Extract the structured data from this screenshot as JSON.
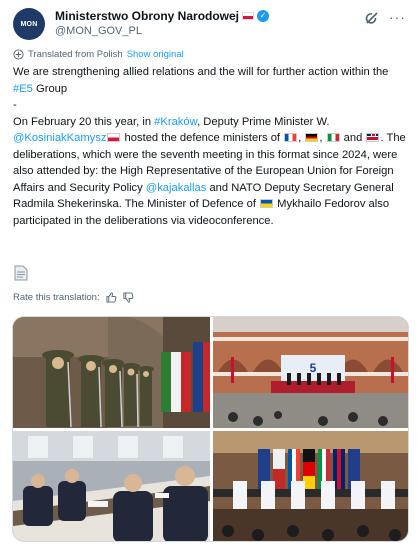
{
  "account": {
    "avatar_text": "MON",
    "display_name": "Ministerstwo Obrony Narodowej",
    "handle": "@MON_GOV_PL"
  },
  "icons": {
    "avatar": "mon-logo",
    "verified": "verified-badge-icon",
    "grok": "grok-icon",
    "more": "more-icon",
    "translate": "translate-icon",
    "document": "document-icon",
    "thumbs_up": "thumbs-up-icon",
    "thumbs_down": "thumbs-down-icon"
  },
  "translation": {
    "notice": "Translated from Polish",
    "show_original": "Show original"
  },
  "tweet": {
    "line1_a": "We are strengthening allied relations and the will for further action within the ",
    "line1_hashtag": "#E5",
    "line1_b": " Group",
    "dash": "-",
    "p2_a": "On February 20 this year, in ",
    "p2_hashtag": "#Kraków",
    "p2_b": ", Deputy Prime Minister W. ",
    "p2_mention1": "@KosiniakKamysz",
    "p2_c": " hosted the defence ministers of ",
    "p2_and": " and ",
    "p2_d": ". The deliberations, which were the seventh meeting in this format since 2024, were also attended by: the High Representative of the European Union for Foreign Affairs and Security Policy ",
    "p2_mention2": "@kajakallas",
    "p2_e": " and NATO Deputy Secretary General Radmila Shekerinska. The Minister of Defence of ",
    "p2_f": " Mykhailo Fedorov also participated in the deliberations via videoconference."
  },
  "rating": {
    "label": "Rate this translation:"
  },
  "colors": {
    "text": "#0f1419",
    "secondary": "#536471",
    "link": "#1d9bf0",
    "border": "#cfd9de"
  }
}
